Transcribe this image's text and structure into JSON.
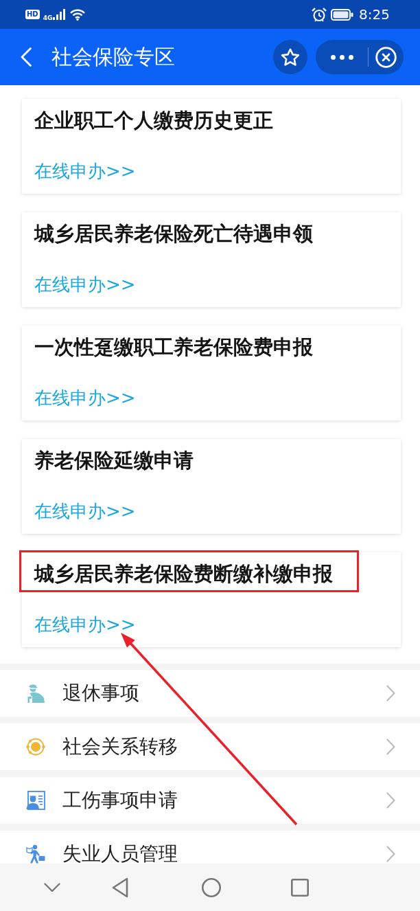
{
  "status_bar": {
    "hd_badge": "HD",
    "network": "4G",
    "time": "8:25"
  },
  "header": {
    "title": "社会保险专区"
  },
  "cards": [
    {
      "title": "企业职工个人缴费历史更正",
      "link": "在线申办>>",
      "highlighted": false,
      "pointed_at": false
    },
    {
      "title": "城乡居民养老保险死亡待遇申领",
      "link": "在线申办>>",
      "highlighted": false,
      "pointed_at": false
    },
    {
      "title": "一次性趸缴职工养老保险费申报",
      "link": "在线申办>>",
      "highlighted": false,
      "pointed_at": false
    },
    {
      "title": "养老保险延缴申请",
      "link": "在线申办>>",
      "highlighted": false,
      "pointed_at": false
    },
    {
      "title": "城乡居民养老保险费断缴补缴申报",
      "link": "在线申办>>",
      "highlighted": true,
      "pointed_at": true
    }
  ],
  "menu": [
    {
      "label": "退休事项"
    },
    {
      "label": "社会关系转移"
    },
    {
      "label": "工伤事项申请"
    },
    {
      "label": "失业人员管理"
    }
  ]
}
